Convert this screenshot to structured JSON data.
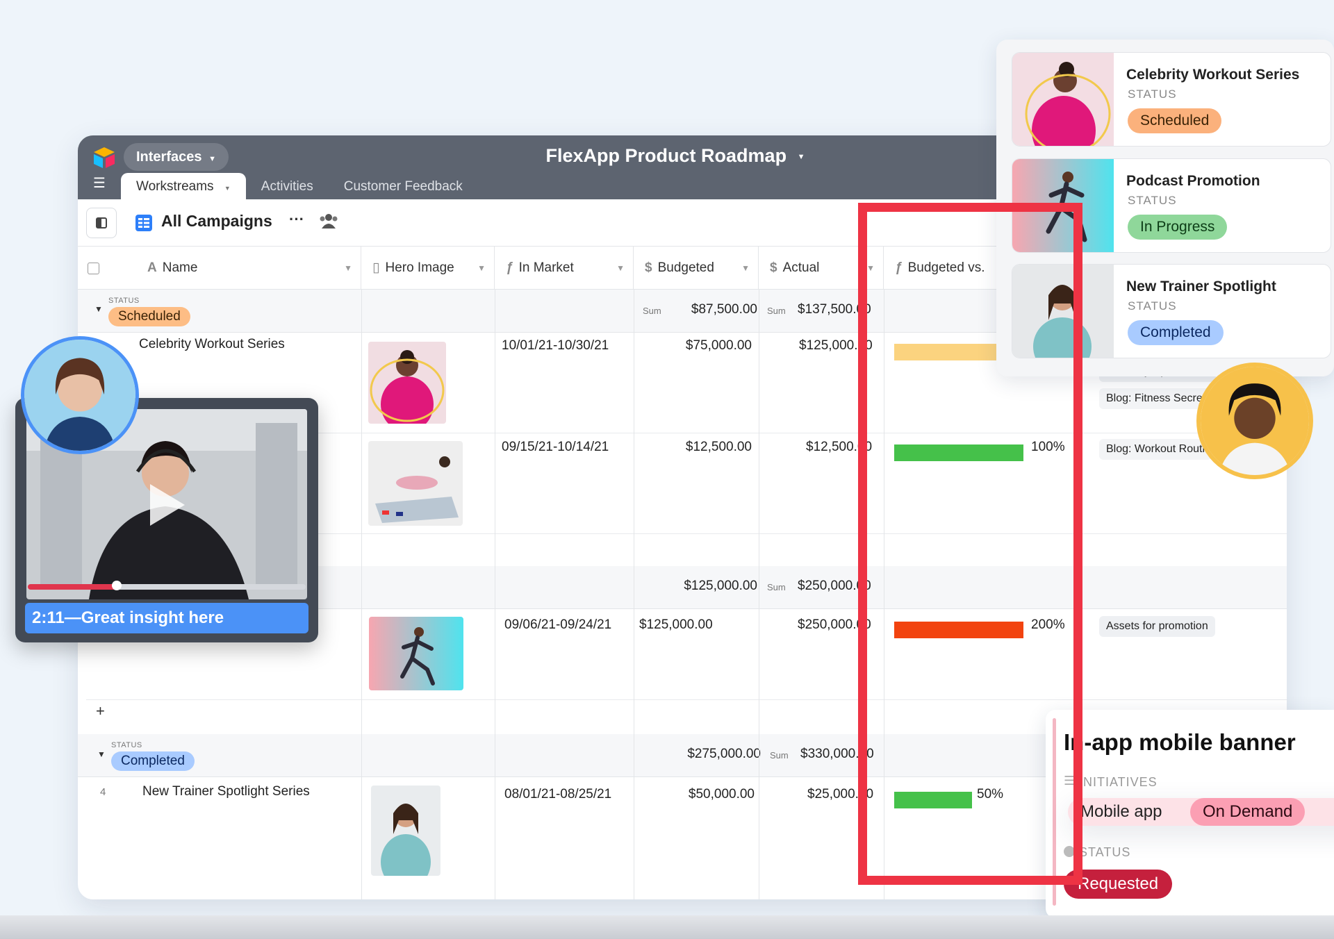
{
  "app": {
    "menu_label": "Interfaces",
    "title": "FlexApp Product Roadmap",
    "tabs": [
      "Workstreams",
      "Activities",
      "Customer Feedback"
    ]
  },
  "toolbar": {
    "view_name": "All Campaigns"
  },
  "columns": {
    "name": "Name",
    "hero_image": "Hero Image",
    "in_market": "In Market",
    "budgeted": "Budgeted",
    "actual": "Actual",
    "budget_vs": "Budgeted vs."
  },
  "group_scheduled": {
    "status_label": "STATUS",
    "status": "Scheduled",
    "sum_label": "Sum",
    "budgeted_sum": "$87,500.00",
    "actual_sum": "$137,500.00"
  },
  "group_middle": {
    "sum_label": "Sum",
    "budgeted_sum": "$125,000.00",
    "actual_sum": "$250,000.00"
  },
  "group_completed": {
    "status_label": "STATUS",
    "status": "Completed",
    "sum_label": "Sum",
    "budgeted_sum": "$275,000.00",
    "actual_sum": "$330,000.00"
  },
  "rows": [
    {
      "name": "Celebrity Workout Series",
      "in_market": "10/01/21-10/30/21",
      "budgeted": "$75,000.00",
      "actual": "$125,000.00",
      "pct": "",
      "links": [
        "Celebrity Spin FB Ad",
        "Blog: Fitness Secre"
      ]
    },
    {
      "name": "",
      "in_market": "09/15/21-10/14/21",
      "budgeted": "$12,500.00",
      "actual": "$12,500.00",
      "pct": "100%",
      "links": [
        "Blog: Workout Routi"
      ]
    },
    {
      "name": "",
      "in_market": "09/06/21-09/24/21",
      "budgeted": "$125,000.00",
      "actual": "$250,000.00",
      "pct": "200%",
      "links": [
        "Assets for promotion"
      ]
    },
    {
      "num": "4",
      "name": "New Trainer Spotlight Series",
      "in_market": "08/01/21-08/25/21",
      "budgeted": "$50,000.00",
      "actual": "$25,000.00",
      "pct": "50%",
      "links": []
    }
  ],
  "bars": {
    "row1_color": "#fbd37f",
    "row2_color": "#45c14a",
    "row3_color": "#f2430f",
    "row4_color": "#45c14a"
  },
  "cards": [
    {
      "title": "Celebrity Workout Series",
      "label": "STATUS",
      "status": "Scheduled"
    },
    {
      "title": "Podcast Promotion",
      "label": "STATUS",
      "status": "In Progress"
    },
    {
      "title": "New Trainer Spotlight",
      "label": "STATUS",
      "status": "Completed"
    }
  ],
  "video": {
    "caption": "2:11—Great insight here",
    "progress": 0.32
  },
  "mobile_card": {
    "title": "In-app mobile banner",
    "initiatives_label": "INITIATIVES",
    "tags": [
      "Mobile app",
      "On Demand"
    ],
    "status_label": "STATUS",
    "status": "Requested"
  },
  "icon_names": [
    "app-logo-icon",
    "chevron-down-icon",
    "hamburger-icon",
    "sidebar-toggle-icon",
    "grid-view-icon",
    "more-icon",
    "people-icon",
    "text-field-icon",
    "attachment-icon",
    "formula-icon",
    "currency-icon",
    "play-icon"
  ],
  "colors": {
    "highlight": "#ee3344",
    "scheduled": "#fdbd85",
    "completed": "#a9cbff",
    "in_progress": "#8fd79a",
    "requested": "#c5203d",
    "caption": "#4b92f7"
  }
}
